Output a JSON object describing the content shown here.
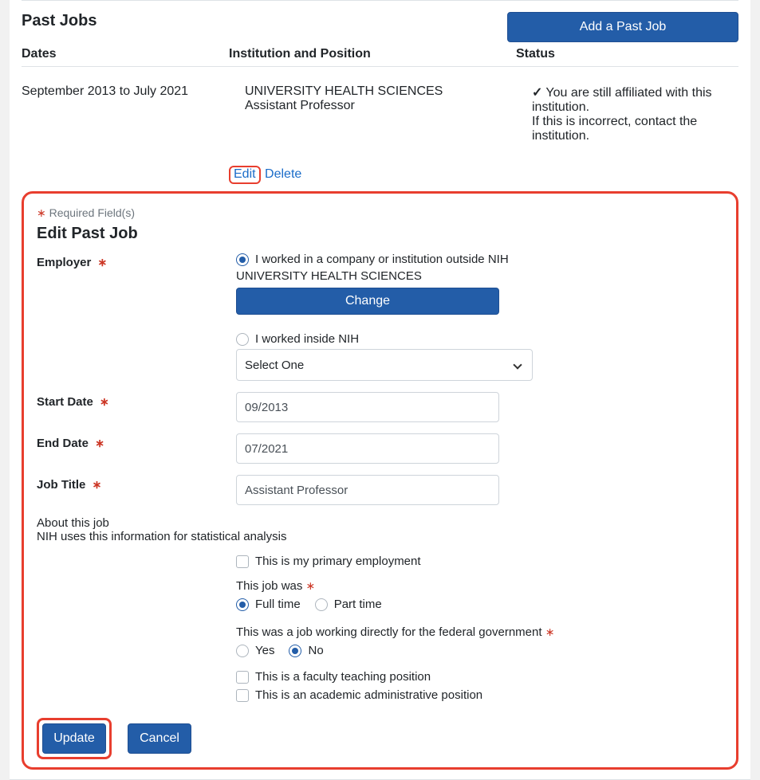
{
  "section": {
    "title": "Past Jobs",
    "add_button": "Add a Past Job",
    "col_dates": "Dates",
    "col_inst": "Institution and Position",
    "col_status": "Status"
  },
  "job": {
    "dates": "September 2013 to July 2021",
    "institution": "UNIVERSITY HEALTH SCIENCES",
    "position": "Assistant Professor",
    "status_line1": "You are still affiliated with this institution.",
    "status_line2": "If this is incorrect, contact the institution.",
    "edit": "Edit",
    "delete": "Delete"
  },
  "form": {
    "required_note": "Required Field(s)",
    "title": "Edit Past Job",
    "labels": {
      "employer": "Employer",
      "start_date": "Start Date",
      "end_date": "End Date",
      "job_title": "Job Title"
    },
    "employer": {
      "outside_label": "I worked in a company or institution outside NIH",
      "inside_label": "I worked inside NIH",
      "name": "UNIVERSITY HEALTH SCIENCES",
      "change": "Change",
      "select_placeholder": "Select One"
    },
    "values": {
      "start_date": "09/2013",
      "end_date": "07/2021",
      "job_title": "Assistant Professor"
    },
    "about_heading": "About this job",
    "about_sub": "NIH uses this information for statistical analysis",
    "primary_label": "This is my primary employment",
    "was_label": "This job was",
    "full_time": "Full time",
    "part_time": "Part time",
    "federal_label": "This was a job working directly for the federal government",
    "yes": "Yes",
    "no": "No",
    "faculty_label": "This is a faculty teaching position",
    "admin_label": "This is an academic administrative position",
    "update": "Update",
    "cancel": "Cancel"
  }
}
